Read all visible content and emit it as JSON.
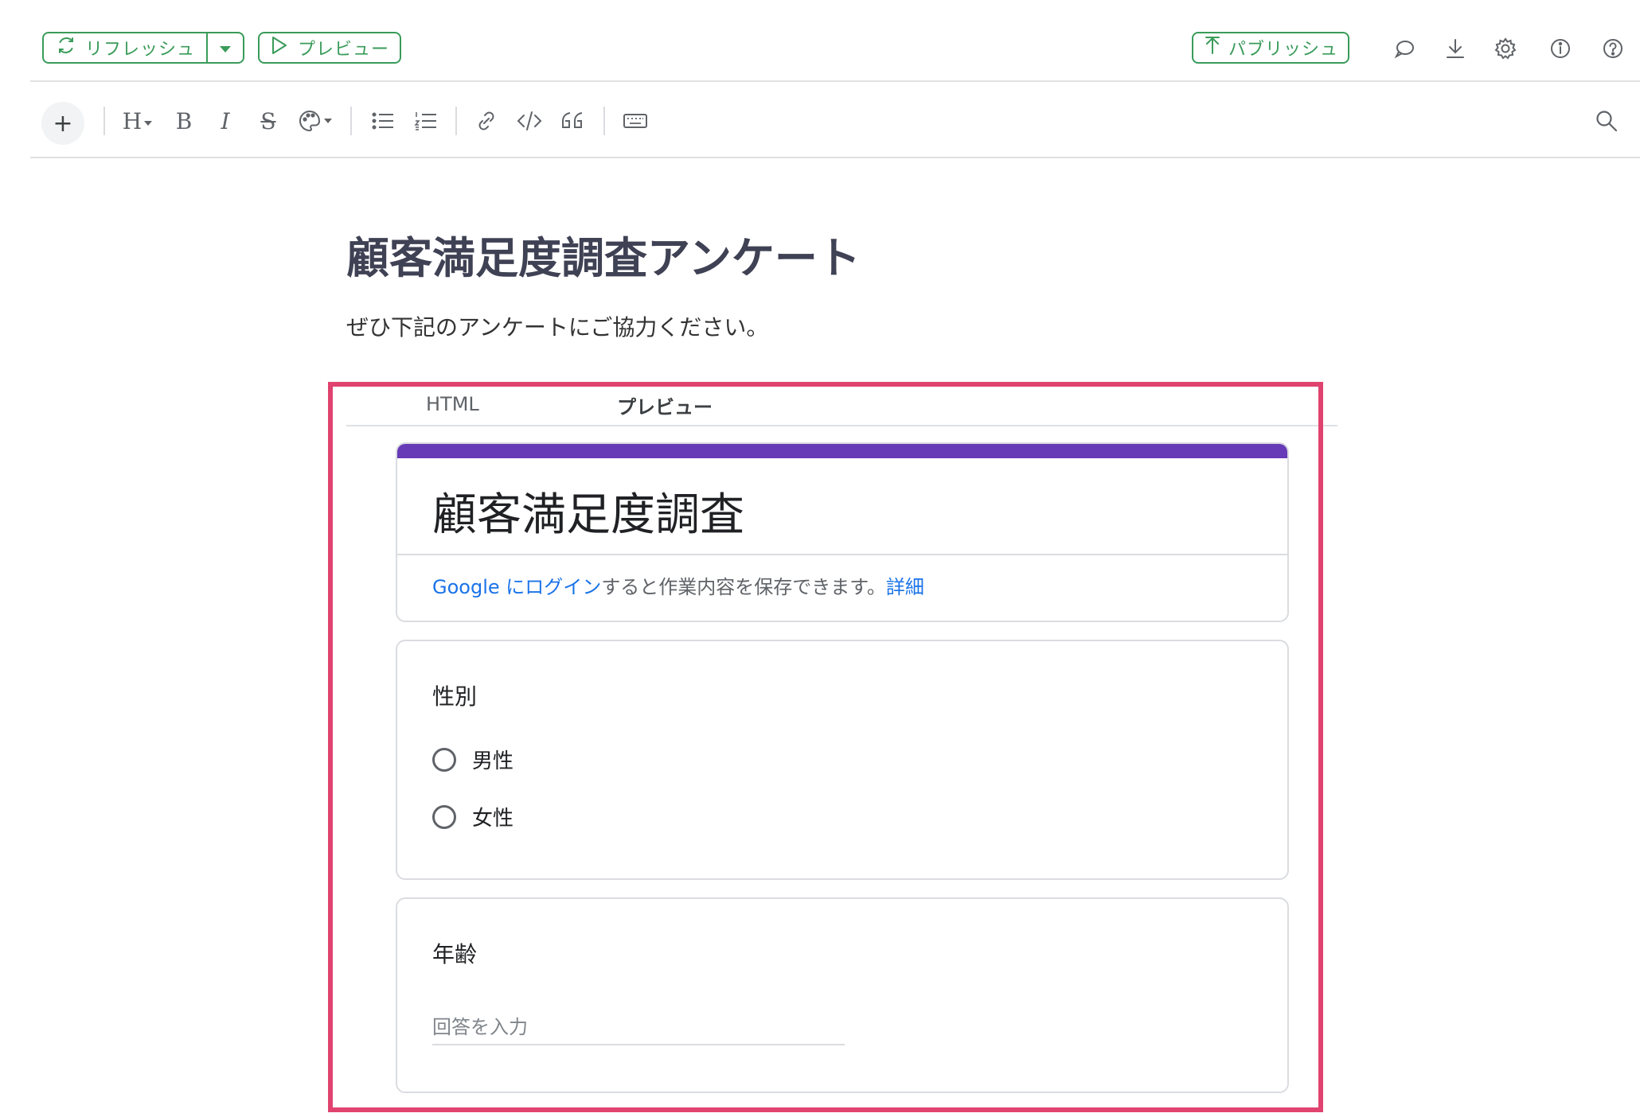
{
  "toolbar": {
    "refresh_label": "リフレッシュ",
    "preview_label": "プレビュー",
    "publish_label": "パブリッシュ",
    "accent_color": "#3a9b5a",
    "right_icons": [
      "comment-icon",
      "download-icon",
      "settings-icon",
      "info-icon",
      "help-icon"
    ]
  },
  "format_toolbar": {
    "insert_label": "+",
    "heading_label": "H",
    "bold_label": "B",
    "italic_label": "I",
    "strike_label": "S",
    "icons": [
      "plus-icon",
      "heading-icon",
      "bold-icon",
      "italic-icon",
      "strikethrough-icon",
      "palette-icon",
      "bullet-list-icon",
      "numbered-list-icon",
      "link-icon",
      "code-icon",
      "quote-icon",
      "keyboard-icon",
      "search-icon"
    ]
  },
  "document": {
    "title": "顧客満足度調査アンケート",
    "description": "ぜひ下記のアンケートにご協力ください。"
  },
  "embed": {
    "tabs": [
      "HTML",
      "プレビュー"
    ],
    "active_tab": "プレビュー",
    "highlight_color": "#e0436f"
  },
  "form": {
    "title": "顧客満足度調査",
    "header_color": "#673ab7",
    "login_link": "Google にログイン",
    "login_text": "すると作業内容を保存できます。",
    "details_link": "詳細",
    "questions": [
      {
        "title": "性別",
        "options": [
          "男性",
          "女性"
        ]
      },
      {
        "title": "年齢",
        "placeholder": "回答を入力"
      }
    ]
  }
}
